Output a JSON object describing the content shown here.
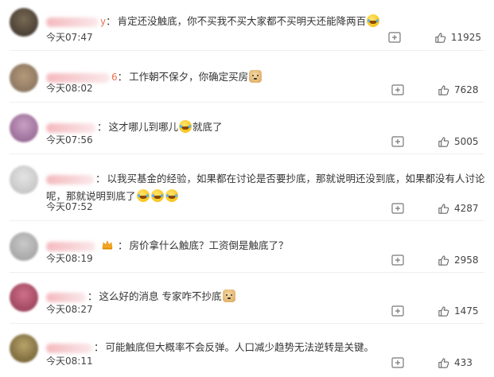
{
  "comments": [
    {
      "name_tail": "y",
      "text": "肯定还没触底，你不买我不买大家都不买明天还能降两百",
      "emoji": "laugh-cry-emoji",
      "time": "今天07:47",
      "likes": "11925"
    },
    {
      "name_tail": "6",
      "text": "工作朝不保夕，你确定买房",
      "emoji": "doge-emoji",
      "time": "今天08:02",
      "likes": "7628"
    },
    {
      "name_tail": "",
      "text_a": "这才哪儿到哪儿",
      "text_b": "就底了",
      "emoji": "laugh-cry-emoji",
      "time": "今天07:56",
      "likes": "5005"
    },
    {
      "name_tail": "",
      "text": "以我买基金的经验，如果都在讨论是否要抄底，那就说明还没到底，如果都没有人讨论呢，那就说明到底了",
      "emoji": "laugh-cry-emoji",
      "time": "今天07:52",
      "likes": "4287"
    },
    {
      "name_tail": "",
      "text": "房价拿什么触底？工资倒是触底了？",
      "badge": "crown-icon",
      "time": "今天08:19",
      "likes": "2958"
    },
    {
      "name_tail": "",
      "text": "这么好的消息 专家咋不抄底",
      "emoji": "doge-emoji",
      "time": "今天08:27",
      "likes": "1475"
    },
    {
      "name_tail": "",
      "text": "可能触底但大概率不会反弹。人口减少趋势无法逆转是关键。",
      "time": "今天08:11",
      "likes": "433"
    }
  ],
  "colors": {
    "text": "#333333",
    "meta": "#444444",
    "username_accent": "#eb7350",
    "divider": "#efefef"
  }
}
